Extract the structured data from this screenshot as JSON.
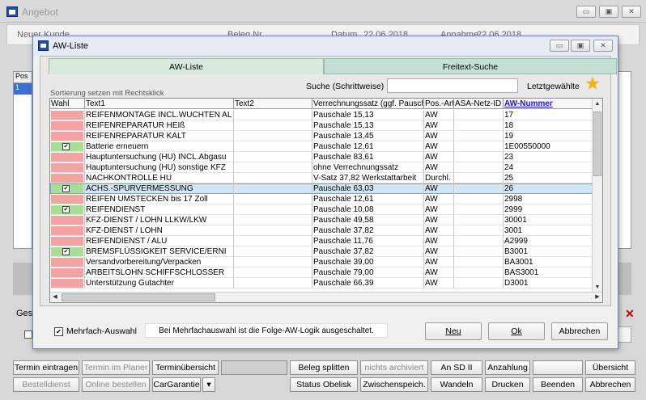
{
  "outer": {
    "title": "Angebot",
    "header": {
      "customer": "Neuer Kunde",
      "beleg": "Beleg Nr.",
      "datum": "Datum",
      "datum_value": "22.06.2018",
      "annahme": "Annahme",
      "annahme_value": "22.06.2018"
    },
    "left_header": "Pos",
    "left_row": "1",
    "ges_label": "Ges"
  },
  "dialog": {
    "title": "AW-Liste",
    "tabs": [
      "AW-Liste",
      "Freitext-Suche"
    ],
    "sort_hint": "Sortierung setzen mit Rechtsklick",
    "search_label": "Suche (Schrittweise)",
    "search_value": "",
    "last_selected_label": "Letztgewählte",
    "columns": [
      "Wahl",
      "Text1",
      "Text2",
      "Verrechnungssatz (ggf. Pauschale)",
      "Pos.-Art",
      "ASA-Netz-ID",
      "AW-Nummer"
    ],
    "rows": [
      {
        "wahl": "red",
        "checked": false,
        "text1": "REIFENMONTAGE INCL.WUCHTEN AL",
        "text2": "",
        "satz": "Pauschale 15,13",
        "art": "AW",
        "asa": "",
        "nr": "17"
      },
      {
        "wahl": "red",
        "checked": false,
        "text1": "REIFENREPARATUR HEIß",
        "text2": "",
        "satz": "Pauschale 15,13",
        "art": "AW",
        "asa": "",
        "nr": "18"
      },
      {
        "wahl": "red",
        "checked": false,
        "text1": "REIFENREPARATUR KALT",
        "text2": "",
        "satz": "Pauschale 13,45",
        "art": "AW",
        "asa": "",
        "nr": "19"
      },
      {
        "wahl": "green",
        "checked": true,
        "text1": "Batterie erneuern",
        "text2": "",
        "satz": "Pauschale 12,61",
        "art": "AW",
        "asa": "",
        "nr": "1E00550000"
      },
      {
        "wahl": "red",
        "checked": false,
        "text1": "Hauptuntersuchung (HU) INCL.Abgasu",
        "text2": "",
        "satz": "Pauschale 83,61",
        "art": "AW",
        "asa": "",
        "nr": "23"
      },
      {
        "wahl": "red",
        "checked": false,
        "text1": "Hauptuntersuchung (HU) sonstige KFZ",
        "text2": "",
        "satz": "ohne Verrechnungssatz",
        "art": "AW",
        "asa": "",
        "nr": "24"
      },
      {
        "wahl": "red",
        "checked": false,
        "text1": "NACHKONTROLLE HU",
        "text2": "",
        "satz": "V-Satz 37,82 Werkstattarbeit",
        "art": "Durchl.",
        "asa": "",
        "nr": "25"
      },
      {
        "wahl": "green",
        "checked": true,
        "text1": "ACHS.-SPURVERMESSUNG",
        "text2": "",
        "satz": "Pauschale 63,03",
        "art": "AW",
        "asa": "",
        "nr": "26"
      },
      {
        "wahl": "red",
        "checked": false,
        "text1": "REIFEN UMSTECKEN bis 17 Zoll",
        "text2": "",
        "satz": "Pauschale 12,61",
        "art": "AW",
        "asa": "",
        "nr": "2998"
      },
      {
        "wahl": "green",
        "checked": true,
        "text1": "REIFENDIENST",
        "text2": "",
        "satz": "Pauschale 10,08",
        "art": "AW",
        "asa": "",
        "nr": "2999"
      },
      {
        "wahl": "red",
        "checked": false,
        "text1": "KFZ-DIENST / LOHN LLKW/LKW",
        "text2": "",
        "satz": "Pauschale 49,58",
        "art": "AW",
        "asa": "",
        "nr": "30001"
      },
      {
        "wahl": "red",
        "checked": false,
        "text1": "KFZ-DIENST / LOHN",
        "text2": "",
        "satz": "Pauschale 37,82",
        "art": "AW",
        "asa": "",
        "nr": "3001"
      },
      {
        "wahl": "red",
        "checked": false,
        "text1": "REIFENDIENST / ALU",
        "text2": "",
        "satz": "Pauschale 11,76",
        "art": "AW",
        "asa": "",
        "nr": "A2999"
      },
      {
        "wahl": "green",
        "checked": true,
        "text1": "BREMSFLÜSSIGKEIT SERVICE/ERNI",
        "text2": "",
        "satz": "Pauschale 37,82",
        "art": "AW",
        "asa": "",
        "nr": "B3001"
      },
      {
        "wahl": "red",
        "checked": false,
        "text1": "Versandvorbereitung/Verpacken",
        "text2": "",
        "satz": "Pauschale 39,00",
        "art": "AW",
        "asa": "",
        "nr": "BA3001"
      },
      {
        "wahl": "red",
        "checked": false,
        "text1": "ARBEITSLOHN SCHIFFSCHLOSSER",
        "text2": "",
        "satz": "Pauschale 79,00",
        "art": "AW",
        "asa": "",
        "nr": "BAS3001"
      },
      {
        "wahl": "red",
        "checked": false,
        "text1": "Unterstützung Gutachter",
        "text2": "",
        "satz": "Pauschale 66,39",
        "art": "AW",
        "asa": "",
        "nr": "D3001"
      }
    ],
    "selected_row": 7,
    "multi_select_label": "Mehrfach-Auswahl",
    "multi_select_checked": true,
    "info_text": "Bei Mehrfachauswahl ist die Folge-AW-Logik ausgeschaltet.",
    "buttons": {
      "new": "Neu",
      "ok": "Ok",
      "cancel": "Abbrechen"
    }
  },
  "toolbar": {
    "row1": [
      "Termin eintragen",
      "Termin im Planer",
      "Terminübersicht",
      "",
      "Beleg splitten",
      "nichts archiviert",
      "An SD II",
      "Anzahlung",
      "",
      "Übersicht"
    ],
    "row2": [
      "Bestelldienst",
      "Online bestellen",
      "CarGarantie",
      "▾",
      "Status Obelisk",
      "Zwischenspeich.",
      "Wandeln",
      "Drucken",
      "Beenden",
      "Abbrechen"
    ]
  },
  "colors": {
    "red_pill": "#f4a3a3",
    "green_pill": "#a9dc94",
    "selection": "#cfe7fb",
    "tab_active": "#d8eadd",
    "tab_inactive": "#c2e1d4",
    "star": "#f5b400"
  }
}
